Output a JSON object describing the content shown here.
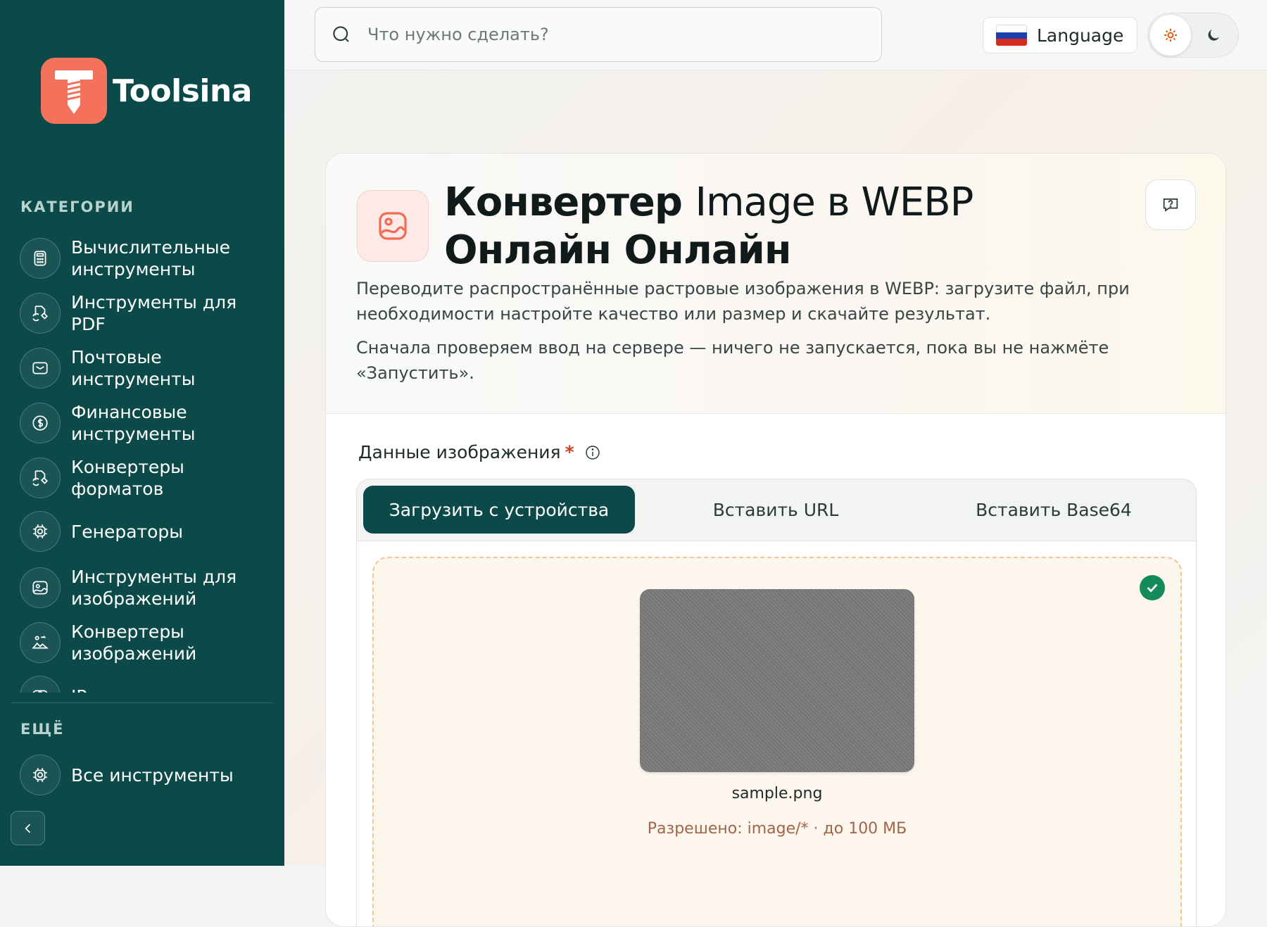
{
  "brand": {
    "name": "Toolsina",
    "accent": "#f4715c",
    "sidebar_bg": "#0c4a4a"
  },
  "sidebar": {
    "categories_title": "КАТЕГОРИИ",
    "categories": [
      {
        "label": "Вычислительные инструменты",
        "icon": "calculator-icon"
      },
      {
        "label": "Инструменты для PDF",
        "icon": "file-convert-icon"
      },
      {
        "label": "Почтовые инструменты",
        "icon": "mail-icon"
      },
      {
        "label": "Финансовые инструменты",
        "icon": "dollar-icon"
      },
      {
        "label": "Конвертеры форматов",
        "icon": "file-convert-icon"
      },
      {
        "label": "Генераторы",
        "icon": "chip-icon"
      },
      {
        "label": "Инструменты для изображений",
        "icon": "image-icon"
      },
      {
        "label": "Конвертеры изображений",
        "icon": "image-convert-icon"
      },
      {
        "label": "IP-инструменты",
        "icon": "globe-icon"
      }
    ],
    "more_title": "ЕЩЁ",
    "more_items": [
      {
        "label": "Все инструменты",
        "icon": "chip-icon"
      }
    ]
  },
  "topbar": {
    "search_placeholder": "Что нужно сделать?",
    "language_label": "Language"
  },
  "tool": {
    "title_bold_1": "Конвертер",
    "title_thin": "Image в WEBP",
    "title_bold_2": "Онлайн Онлайн",
    "description": "Переводите распространённые растровые изображения в WEBP: загрузите файл, при необходимости настройте качество или размер и скачайте результат.",
    "note": "Сначала проверяем ввод на сервере — ничего не запускается, пока вы не нажмёте «Запустить».",
    "field_label": "Данные изображения",
    "required_mark": "*",
    "tabs": [
      "Загрузить с устройства",
      "Вставить URL",
      "Вставить Base64"
    ],
    "active_tab": 0,
    "upload": {
      "filename": "sample.png",
      "allowed": "Разрешено: image/* · до 100 МБ"
    }
  }
}
